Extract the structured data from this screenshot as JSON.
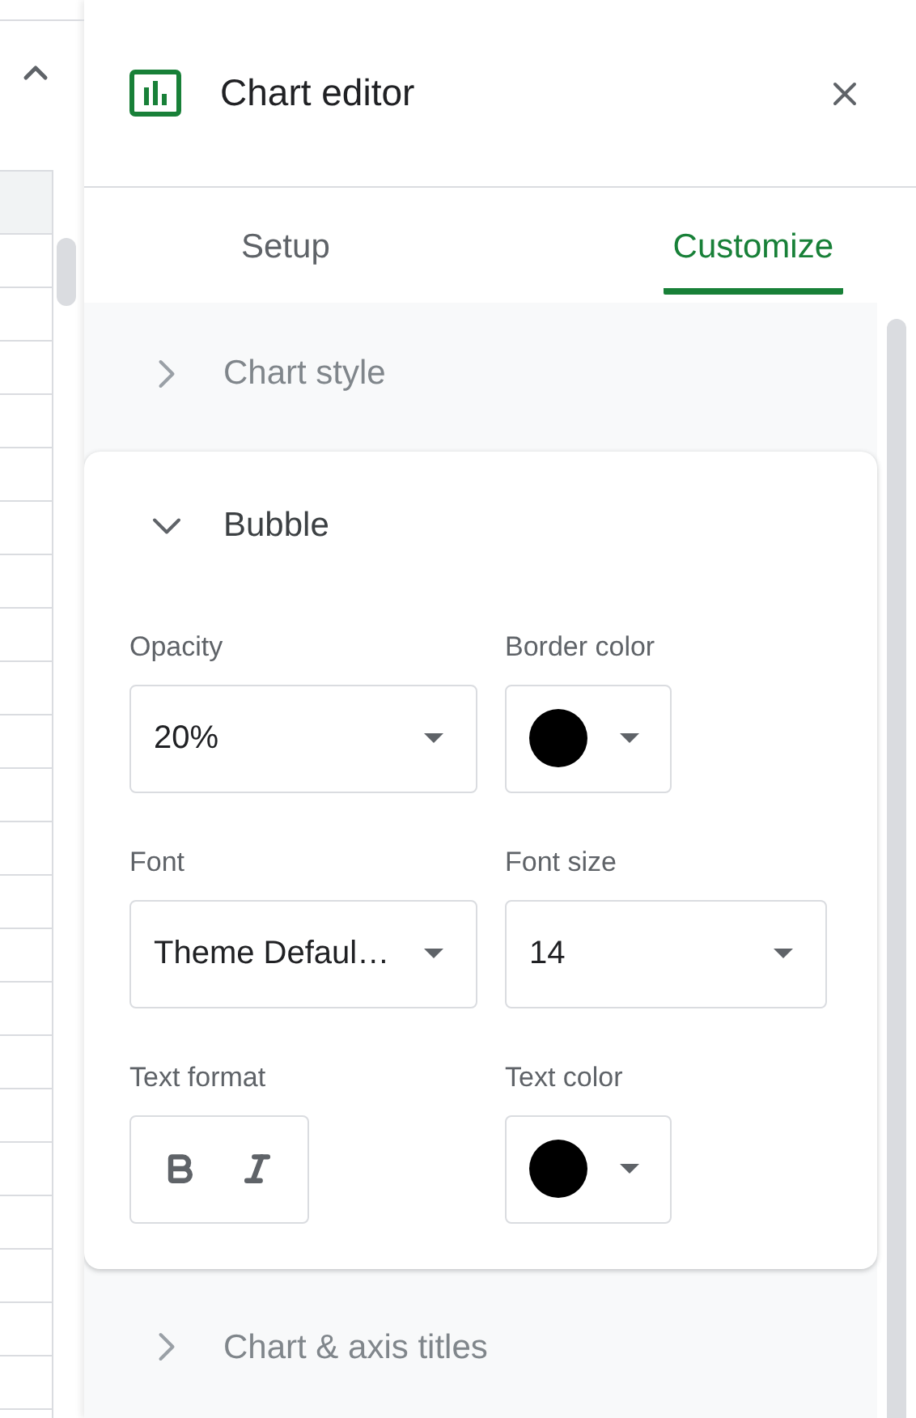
{
  "panel": {
    "title": "Chart editor"
  },
  "tabs": [
    {
      "label": "Setup",
      "selected": false
    },
    {
      "label": "Customize",
      "selected": true
    }
  ],
  "sections": [
    {
      "title": "Chart style",
      "expanded": false
    },
    {
      "title": "Bubble",
      "expanded": true,
      "fields": [
        {
          "kind": "select",
          "label": "Opacity",
          "value": "20%"
        },
        {
          "kind": "color",
          "label": "Border color",
          "color": "#000000"
        },
        {
          "kind": "select",
          "label": "Font",
          "value": "Theme Defaul…"
        },
        {
          "kind": "select",
          "label": "Font size",
          "value": "14"
        },
        {
          "kind": "format",
          "label": "Text format",
          "bold": false,
          "italic": false
        },
        {
          "kind": "color",
          "label": "Text color",
          "color": "#000000"
        }
      ]
    },
    {
      "title": "Chart & axis titles",
      "expanded": false
    }
  ]
}
